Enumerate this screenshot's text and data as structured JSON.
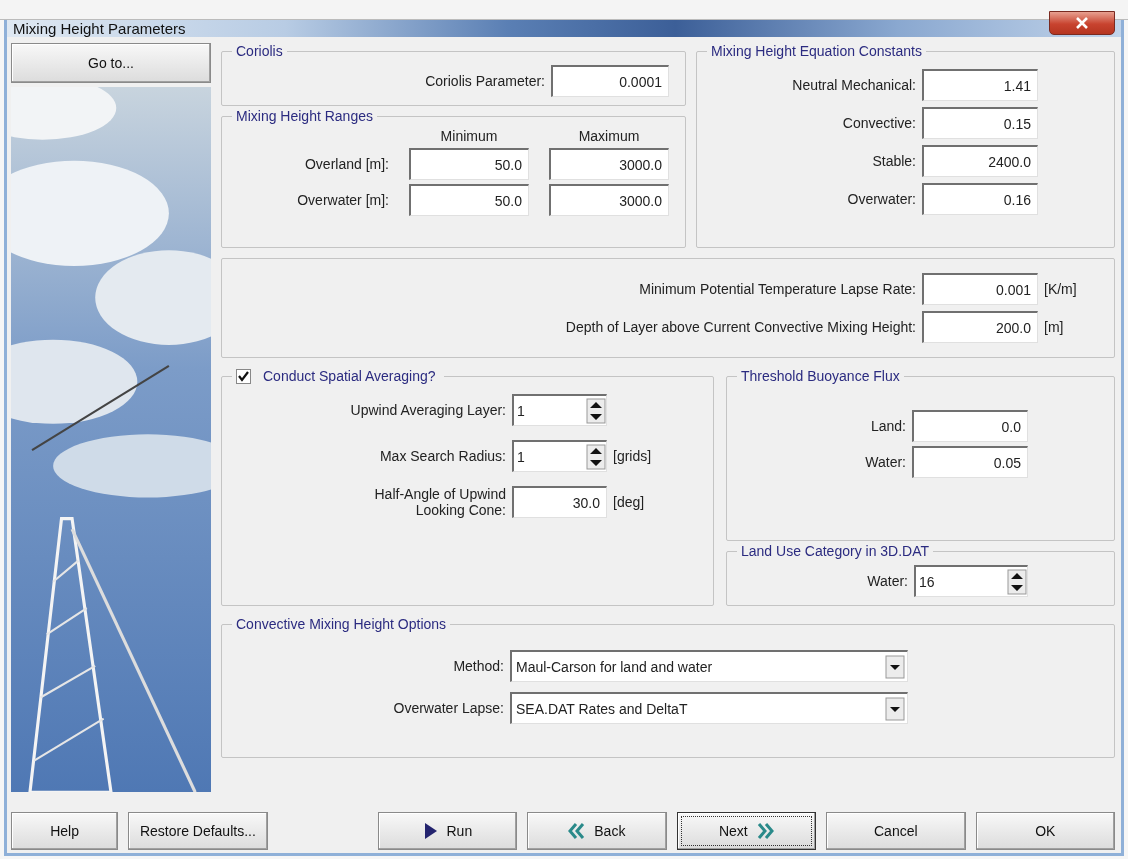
{
  "window": {
    "title": "Mixing Height Parameters"
  },
  "sidebar": {
    "goto_button": "Go to..."
  },
  "coriolis": {
    "title": "Coriolis",
    "fields": [
      {
        "kind": "text",
        "label": "Coriolis Parameter:",
        "value": "0.0001"
      }
    ]
  },
  "ranges": {
    "title": "Mixing Height Ranges",
    "columns": [
      "Minimum",
      "Maximum"
    ],
    "rows": [
      {
        "label": "Overland [m]:",
        "minimum": "50.0",
        "maximum": "3000.0"
      },
      {
        "label": "Overwater [m]:",
        "minimum": "50.0",
        "maximum": "3000.0"
      }
    ]
  },
  "constants": {
    "title": "Mixing Height Equation Constants",
    "fields": [
      {
        "kind": "text",
        "label": "Neutral Mechanical:",
        "value": "1.41"
      },
      {
        "kind": "text",
        "label": "Convective:",
        "value": "0.15"
      },
      {
        "kind": "text",
        "label": "Stable:",
        "value": "2400.0"
      },
      {
        "kind": "text",
        "label": "Overwater:",
        "value": "0.16"
      }
    ]
  },
  "lapse": {
    "fields": [
      {
        "kind": "text",
        "label": "Minimum Potential Temperature Lapse Rate:",
        "value": "0.001",
        "unit": "[K/m]"
      },
      {
        "kind": "text",
        "label": "Depth of Layer above Current Convective Mixing Height:",
        "value": "200.0",
        "unit": "[m]"
      }
    ]
  },
  "spatial": {
    "title": "Conduct Spatial Averaging?",
    "checked": true,
    "fields": [
      {
        "kind": "spinner",
        "label": "Upwind Averaging Layer:",
        "value": "1"
      },
      {
        "kind": "spinner",
        "label": "Max Search Radius:",
        "value": "1",
        "unit": "[grids]"
      },
      {
        "kind": "text",
        "label": "Half-Angle of Upwind\nLooking Cone:",
        "value": "30.0",
        "unit": "[deg]"
      }
    ]
  },
  "threshold": {
    "title": "Threshold Buoyance Flux",
    "fields": [
      {
        "kind": "text",
        "label": "Land:",
        "value": "0.0"
      },
      {
        "kind": "text",
        "label": "Water:",
        "value": "0.05"
      }
    ]
  },
  "land_use": {
    "title": "Land Use Category in 3D.DAT",
    "fields": [
      {
        "kind": "spinner",
        "label": "Water:",
        "value": "16"
      }
    ]
  },
  "convective": {
    "title": "Convective Mixing Height Options",
    "fields": [
      {
        "label": "Method:",
        "value": "Maul-Carson for land and water"
      },
      {
        "label": "Overwater Lapse:",
        "value": "SEA.DAT Rates and DeltaT"
      }
    ]
  },
  "buttons": [
    {
      "label": "Help",
      "kind": "plain",
      "focused": false
    },
    {
      "label": "Restore Defaults...",
      "kind": "plain",
      "focused": false
    },
    {
      "label": "Run",
      "kind": "run",
      "focused": false
    },
    {
      "label": "Back",
      "kind": "back",
      "focused": false
    },
    {
      "label": "Next",
      "kind": "next",
      "focused": true
    },
    {
      "label": "Cancel",
      "kind": "plain",
      "focused": false
    },
    {
      "label": "OK",
      "kind": "plain",
      "focused": false
    }
  ]
}
